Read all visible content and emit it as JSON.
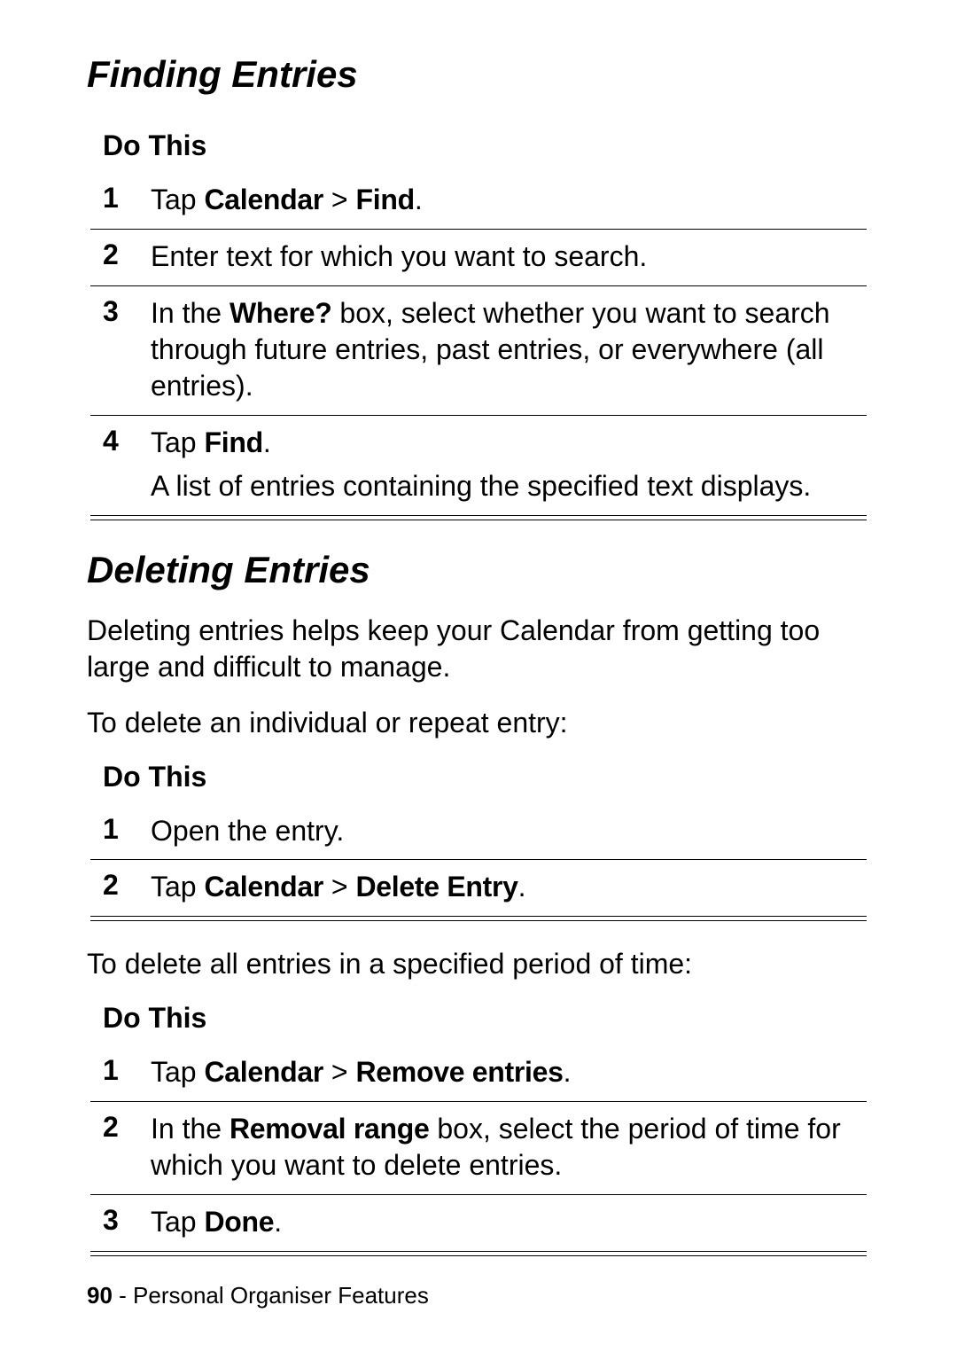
{
  "sections": {
    "finding": {
      "title": "Finding Entries",
      "do_header": "Do This",
      "steps": [
        {
          "num": "1",
          "parts": [
            {
              "t": "Tap "
            },
            {
              "t": "Calendar",
              "cond": true
            },
            {
              "t": " > "
            },
            {
              "t": "Find",
              "cond": true
            },
            {
              "t": "."
            }
          ]
        },
        {
          "num": "2",
          "parts": [
            {
              "t": "Enter text for which you want to search."
            }
          ]
        },
        {
          "num": "3",
          "parts": [
            {
              "t": "In the "
            },
            {
              "t": "Where?",
              "cond": true
            },
            {
              "t": " box, select whether you want to search through future entries, past entries, or everywhere (all entries)."
            }
          ]
        },
        {
          "num": "4",
          "paragraphs": [
            [
              {
                "t": "Tap "
              },
              {
                "t": "Find",
                "cond": true
              },
              {
                "t": "."
              }
            ],
            [
              {
                "t": "A list of entries containing the specified text displays."
              }
            ]
          ]
        }
      ]
    },
    "deleting": {
      "title": "Deleting Entries",
      "intro": "Deleting entries helps keep your Calendar from getting too large and difficult to manage.",
      "para2": "To delete an individual or repeat entry:",
      "do_header": "Do This",
      "steps1": [
        {
          "num": "1",
          "parts": [
            {
              "t": "Open the entry."
            }
          ]
        },
        {
          "num": "2",
          "parts": [
            {
              "t": "Tap "
            },
            {
              "t": "Calendar",
              "cond": true
            },
            {
              "t": " > "
            },
            {
              "t": "Delete Entry",
              "cond": true
            },
            {
              "t": "."
            }
          ]
        }
      ],
      "para3": "To delete all entries in a specified period of time:",
      "do_header2": "Do This",
      "steps2": [
        {
          "num": "1",
          "parts": [
            {
              "t": "Tap "
            },
            {
              "t": "Calendar",
              "cond": true
            },
            {
              "t": " > "
            },
            {
              "t": "Remove entries",
              "cond": true
            },
            {
              "t": "."
            }
          ]
        },
        {
          "num": "2",
          "parts": [
            {
              "t": "In the "
            },
            {
              "t": "Removal range",
              "cond": true
            },
            {
              "t": " box, select the period of time for which you want to delete entries."
            }
          ]
        },
        {
          "num": "3",
          "parts": [
            {
              "t": "Tap "
            },
            {
              "t": "Done",
              "cond": true
            },
            {
              "t": "."
            }
          ]
        }
      ]
    }
  },
  "footer": {
    "page_num": "90",
    "sep": " - ",
    "section": "Personal Organiser Features"
  }
}
